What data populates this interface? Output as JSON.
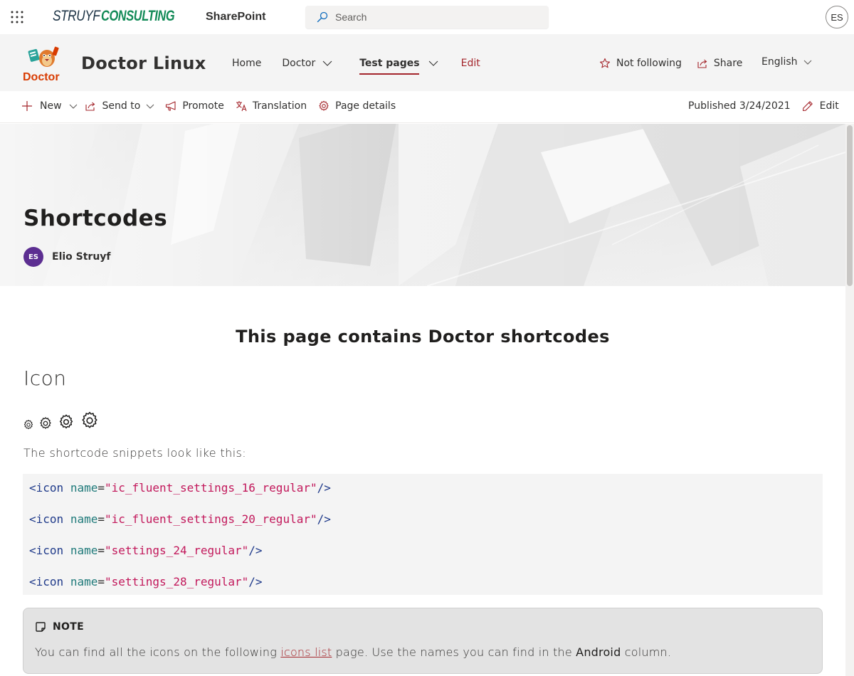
{
  "suite_bar": {
    "brand_part1": "STRUYF",
    "brand_part2": "CONSULTING",
    "app_name": "SharePoint",
    "search_placeholder": "Search",
    "user_initials": "ES"
  },
  "site_header": {
    "logo_text": "Doctor",
    "title": "Doctor Linux",
    "nav": {
      "home": "Home",
      "doctor": "Doctor",
      "test_pages": "Test pages",
      "edit": "Edit"
    },
    "follow_label": "Not following",
    "share_label": "Share",
    "language": "English"
  },
  "command_bar": {
    "new": "New",
    "send_to": "Send to",
    "promote": "Promote",
    "translation": "Translation",
    "page_details": "Page details",
    "published": "Published 3/24/2021",
    "edit": "Edit"
  },
  "hero": {
    "title": "Shortcodes",
    "author_initials": "ES",
    "author_name": "Elio Struyf"
  },
  "content": {
    "heading": "This page contains Doctor shortcodes",
    "section_title": "Icon",
    "gear_icons": [
      "settings-16-icon",
      "settings-20-icon",
      "settings-24-icon",
      "settings-28-icon"
    ],
    "snippet_lead": "The shortcode snippets look like this:",
    "code": {
      "tag_open": "<icon",
      "attr": "name",
      "eq": "=",
      "close": "/>",
      "values": [
        "\"ic_fluent_settings_16_regular\"",
        "\"ic_fluent_settings_20_regular\"",
        "\"settings_24_regular\"",
        "\"settings_28_regular\""
      ]
    },
    "note": {
      "label": "NOTE",
      "text_before": "You can find all the icons on the following ",
      "link": "icons list",
      "text_middle": " page. Use the names you can find in the ",
      "bold": "Android",
      "text_after": " column."
    }
  },
  "colors": {
    "accent": "#a4262c",
    "avatar": "#5c2e91",
    "brand_green": "#128a57"
  }
}
